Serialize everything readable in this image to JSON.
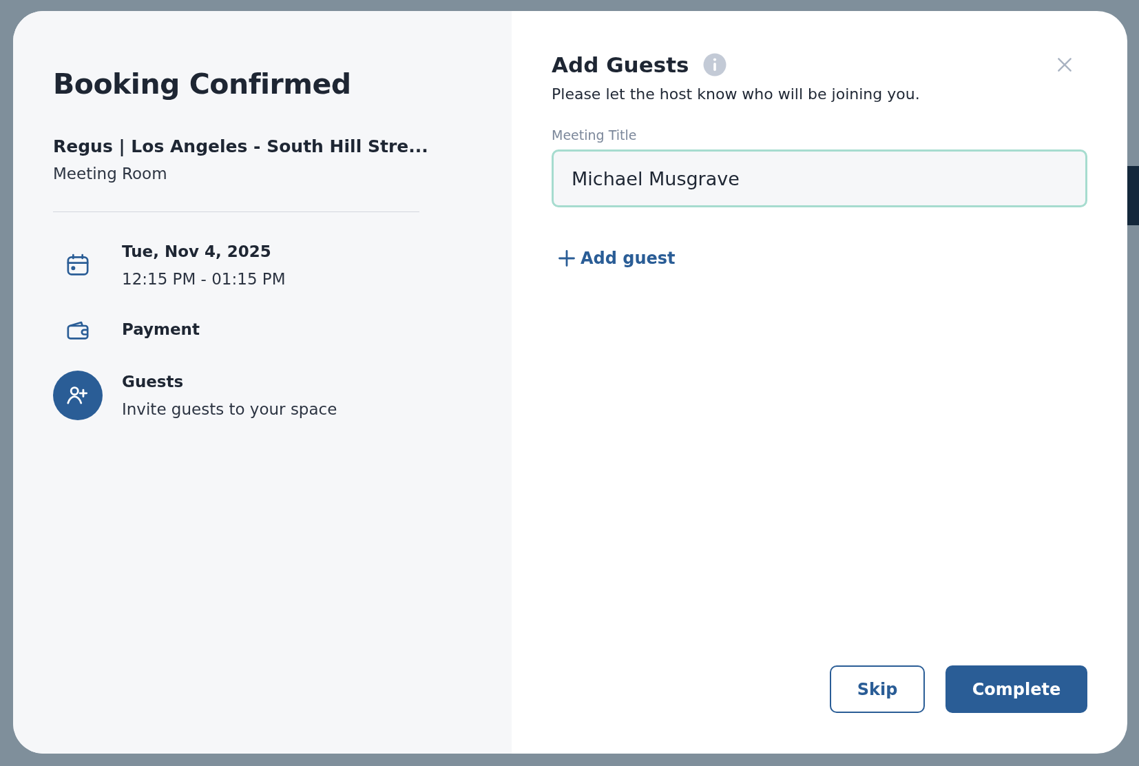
{
  "summary": {
    "title": "Booking Confirmed",
    "location": "Regus | Los Angeles - South Hill Stre...",
    "room_type": "Meeting Room",
    "items": [
      {
        "kind": "calendar",
        "title": "Tue, Nov 4, 2025",
        "subtitle": "12:15 PM - 01:15 PM",
        "selected": false
      },
      {
        "kind": "wallet",
        "title": "Payment",
        "selected": false
      },
      {
        "kind": "guests",
        "title": "Guests",
        "subtitle": "Invite guests to your space",
        "selected": true
      }
    ]
  },
  "guests_panel": {
    "title": "Add Guests",
    "description": "Please let the host know who will be joining you.",
    "meeting_title": {
      "label": "Meeting Title",
      "value": "Michael Musgrave"
    },
    "add_guest": "Add guest",
    "buttons": [
      {
        "kind": "secondary",
        "label": "Skip"
      },
      {
        "kind": "primary",
        "label": "Complete"
      }
    ]
  }
}
